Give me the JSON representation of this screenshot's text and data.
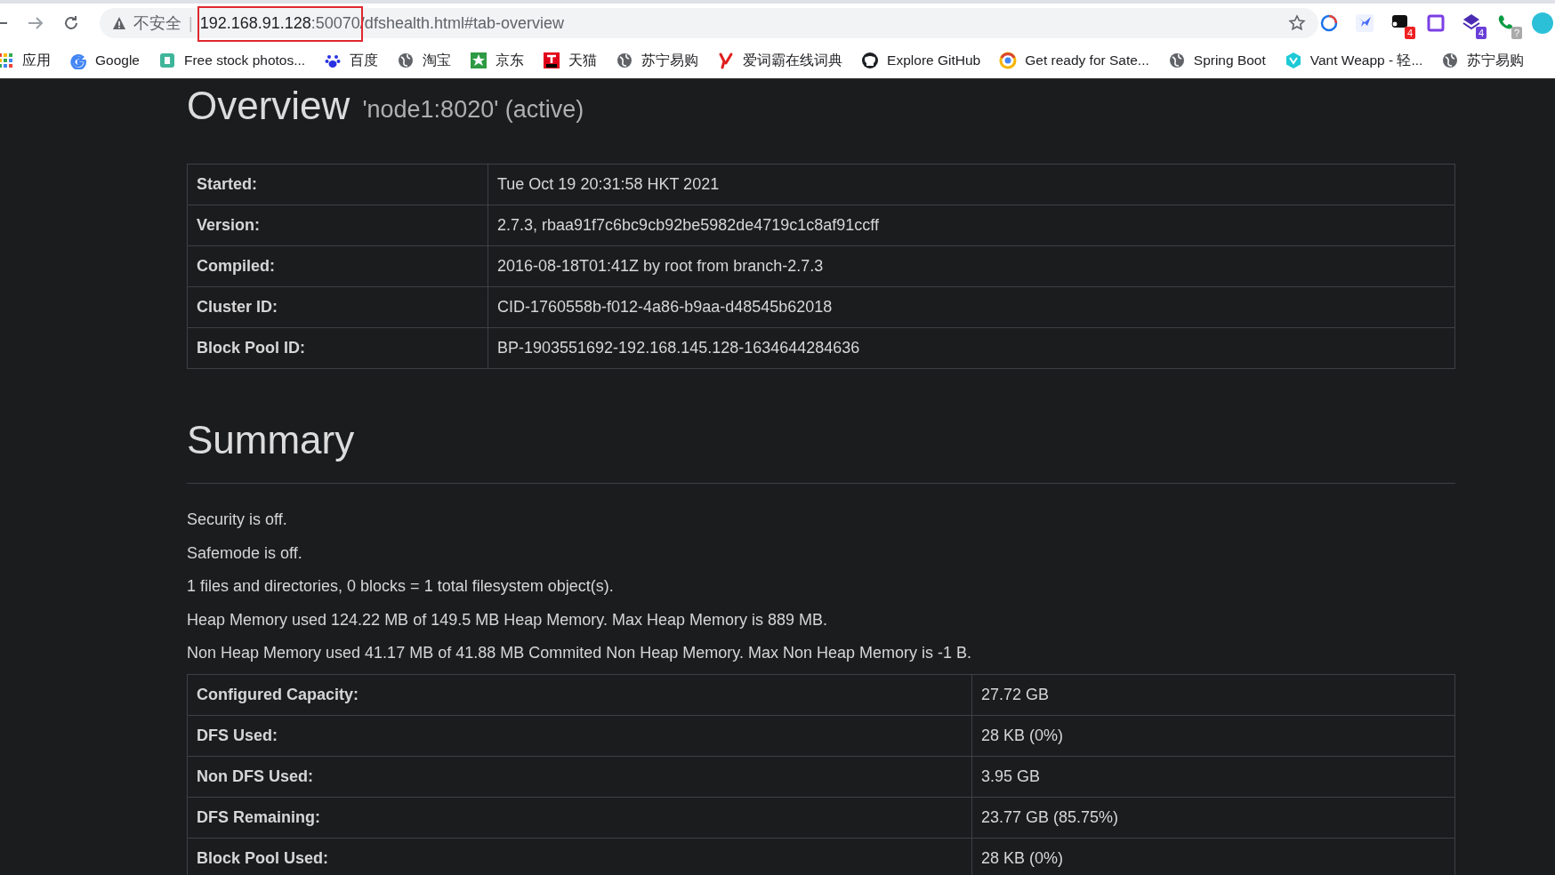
{
  "address_bar": {
    "security_label": "不安全",
    "separator": "|",
    "url_host": "192.168.91.128",
    "url_rest": ":50070/dfshealth.html#tab-overview",
    "highlighted": true
  },
  "extensions": [
    {
      "kind": "ring"
    },
    {
      "kind": "bird"
    },
    {
      "kind": "dark",
      "badge": "4"
    },
    {
      "kind": "square"
    },
    {
      "kind": "stack",
      "badge": "4"
    },
    {
      "kind": "phone",
      "badge": "?"
    },
    {
      "kind": "avatar"
    }
  ],
  "bookmarks": [
    {
      "kind": "apps",
      "label": "应用"
    },
    {
      "kind": "google",
      "label": "Google"
    },
    {
      "kind": "tile",
      "label": "Free stock photos..."
    },
    {
      "kind": "paw",
      "label": "百度"
    },
    {
      "kind": "globe",
      "label": "淘宝"
    },
    {
      "kind": "star",
      "label": "京东"
    },
    {
      "kind": "tmall",
      "label": "天猫"
    },
    {
      "kind": "globe",
      "label": "苏宁易购"
    },
    {
      "kind": "y",
      "label": "爱词霸在线词典"
    },
    {
      "kind": "github",
      "label": "Explore GitHub"
    },
    {
      "kind": "chrome",
      "label": "Get ready for Sate..."
    },
    {
      "kind": "globe",
      "label": "Spring Boot"
    },
    {
      "kind": "vant",
      "label": "Vant Weapp - 轻..."
    },
    {
      "kind": "globe",
      "label": "苏宁易购"
    }
  ],
  "overview": {
    "title": "Overview",
    "subtitle": "'node1:8020' (active)",
    "rows": [
      {
        "label": "Started:",
        "value": "Tue Oct 19 20:31:58 HKT 2021"
      },
      {
        "label": "Version:",
        "value": "2.7.3, rbaa91f7c6bc9cb92be5982de4719c1c8af91ccff"
      },
      {
        "label": "Compiled:",
        "value": "2016-08-18T01:41Z by root from branch-2.7.3"
      },
      {
        "label": "Cluster ID:",
        "value": "CID-1760558b-f012-4a86-b9aa-d48545b62018"
      },
      {
        "label": "Block Pool ID:",
        "value": "BP-1903551692-192.168.145.128-1634644284636"
      }
    ]
  },
  "summary": {
    "title": "Summary",
    "lines": [
      "Security is off.",
      "Safemode is off.",
      "1 files and directories, 0 blocks = 1 total filesystem object(s).",
      "Heap Memory used 124.22 MB of 149.5 MB Heap Memory. Max Heap Memory is 889 MB.",
      "Non Heap Memory used 41.17 MB of 41.88 MB Commited Non Heap Memory. Max Non Heap Memory is -1 B."
    ],
    "rows": [
      {
        "label": "Configured Capacity:",
        "value": "27.72 GB"
      },
      {
        "label": "DFS Used:",
        "value": "28 KB (0%)"
      },
      {
        "label": "Non DFS Used:",
        "value": "3.95 GB"
      },
      {
        "label": "DFS Remaining:",
        "value": "23.77 GB (85.75%)"
      },
      {
        "label": "Block Pool Used:",
        "value": "28 KB (0%)"
      }
    ]
  }
}
